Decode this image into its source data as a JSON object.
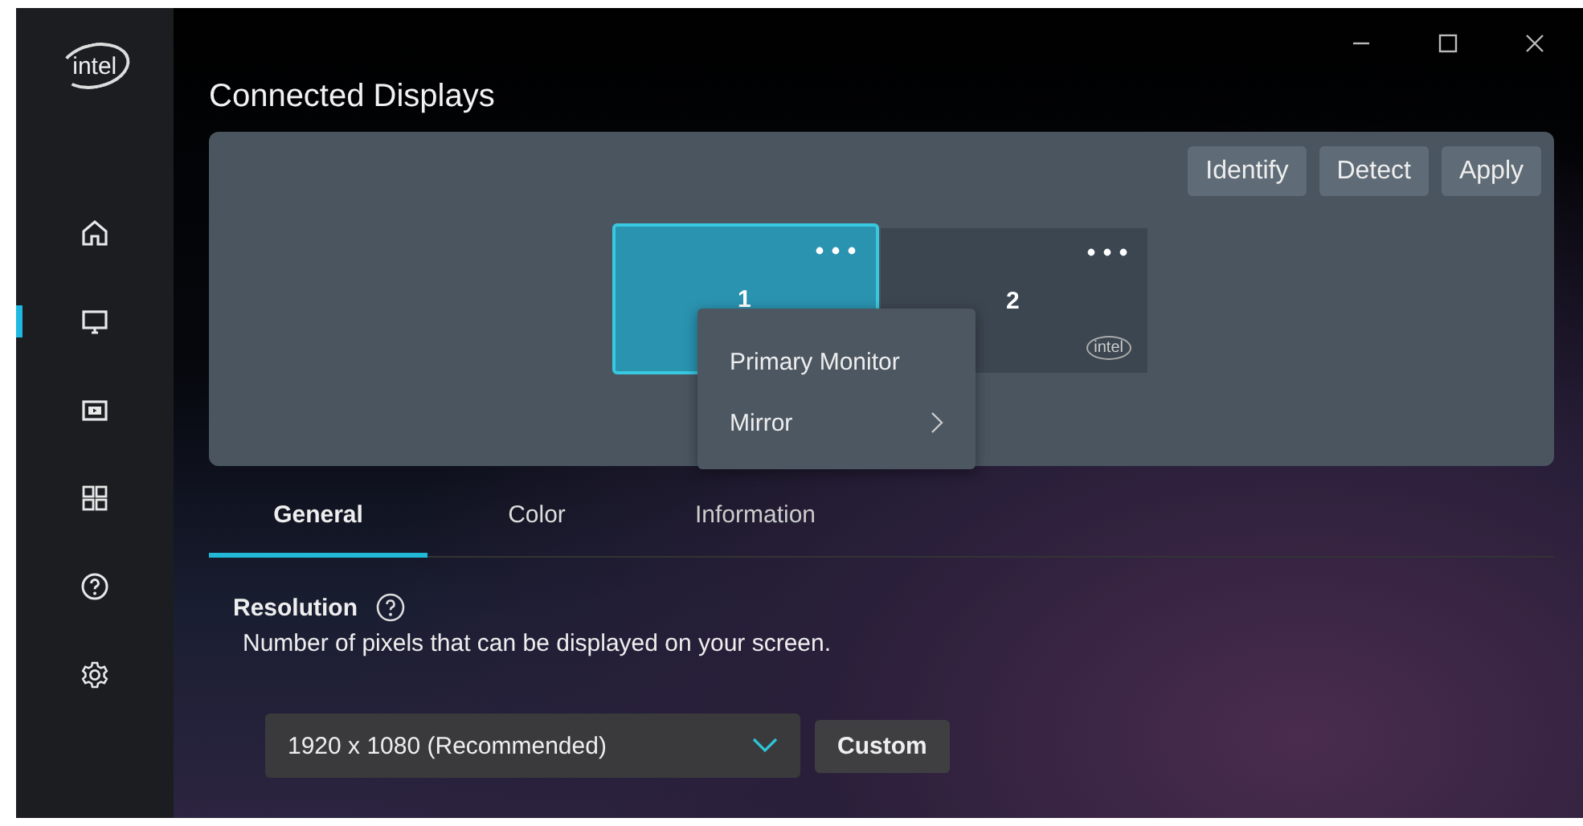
{
  "logo": "intel",
  "sidebar": {
    "items": [
      {
        "selected": false
      },
      {
        "selected": true
      },
      {
        "selected": false
      },
      {
        "selected": false
      },
      {
        "selected": false
      },
      {
        "selected": false
      }
    ]
  },
  "title": "Connected Displays",
  "actions": [
    "Identify",
    "Detect",
    "Apply"
  ],
  "monitors": [
    {
      "number": "1",
      "selected": true
    },
    {
      "number": "2",
      "selected": false,
      "brand": "intel"
    }
  ],
  "context_menu": [
    {
      "label": "Primary Monitor",
      "submenu": false
    },
    {
      "label": "Mirror",
      "submenu": true
    }
  ],
  "tabs": [
    {
      "label": "General",
      "selected": true
    },
    {
      "label": "Color",
      "selected": false
    },
    {
      "label": "Information",
      "selected": false
    }
  ],
  "resolution": {
    "heading": "Resolution",
    "description": "Number of pixels that can be displayed on your screen.",
    "value": "1920 x 1080 (Recommended)",
    "custom_button": "Custom"
  }
}
